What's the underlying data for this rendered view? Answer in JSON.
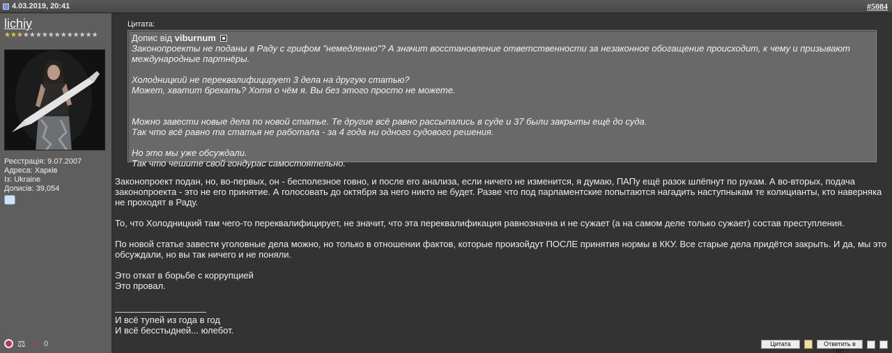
{
  "header": {
    "date": "4.03.2019, 20:41",
    "post_number": "#5084"
  },
  "user": {
    "name": "lichiy",
    "stars_filled": 3,
    "stars_total": 15,
    "reg_label": "Реєстрація: 9.07.2007",
    "address_label": "Адреса: Харків",
    "from_label": "Із: Ukraine",
    "posts_label": "Дописів: 39,054",
    "counter_value": "0"
  },
  "quote": {
    "label": "Цитата:",
    "author_prefix": "Допис від",
    "author": "viburnum",
    "lines": [
      "Законопроекты не поданы в Раду с грифом \"немедленно\"? А значит восстановление ответственности за незаконное обогащение происходит, к чему и призывают международные партнёры.",
      "",
      "Холодницкий не переквалифицирует 3 дела на другую статью?",
      "Может, хватит брехать? Хотя о чём я. Вы без этого просто не можете.",
      "",
      "",
      "Можно завести новые дела по новой статье. Те другие всё равно рассыпались в суде и 37 были закрыты ещё до суда.",
      "Так что всё равно та статья не работала - за 4 года ни одного судового решения.",
      "",
      "Но это мы уже обсуждали.",
      "Так что чешите свой гондурас самостоятельно."
    ]
  },
  "message": {
    "p1": "Законопроект подан, но, во-первых, он - бесполезное говно, и после его анализа, если ничего не изменится, я думаю, ПАПу ещё разок шлёпнут по рукам. А во-вторых, подача законопроекта - это не его принятие. А голосовать до октября за него никто не будет. Разве что под парламентские попытаются нагадить наступныкам те колицианты, кто наверняка не проходят в Раду.",
    "p2": "То, что Холодницкий там чего-то переквалифицирует, не значит, что эта переквалификация равнозначна и не сужает (а на самом деле только сужает) состав преступления.",
    "p3": "По новой статье завести уголовные дела можно, но только в отношении фактов, которые произойдут ПОСЛЕ принятия нормы в ККУ. Все старые дела придётся закрыть. И да, мы это обсуждали, но вы так ничего и не поняли.",
    "p4a": "Это откат в борьбе с коррупцией",
    "p4b": "Это провал."
  },
  "signature": {
    "line1": "И всё тупей из года в год",
    "line2": "И всё бесстыдней... юлебот."
  },
  "buttons": {
    "quote": "Цитата",
    "reply_pm": "Ответить в ЛС"
  }
}
